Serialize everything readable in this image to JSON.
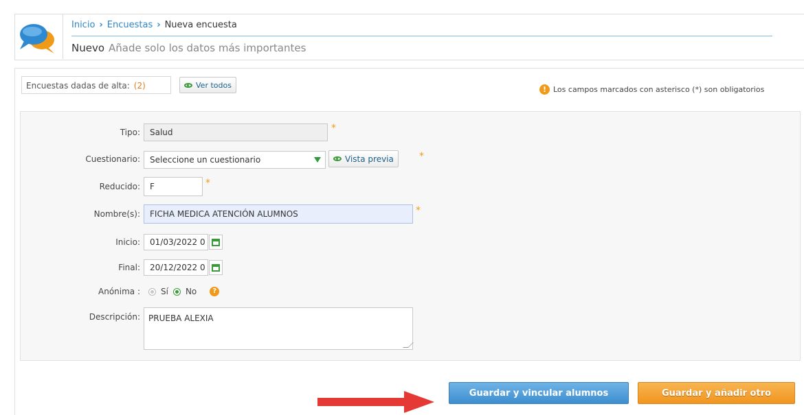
{
  "breadcrumb": {
    "home": "Inicio",
    "section": "Encuestas",
    "current": "Nueva encuesta"
  },
  "header": {
    "title": "Nuevo",
    "subtitle": "Añade solo los datos más importantes"
  },
  "summary": {
    "label": "Encuestas dadas de alta:",
    "count": "(2)",
    "view_all": "Ver todos"
  },
  "note": {
    "required_text": "Los campos marcados con asterisco (*) son obligatorios",
    "icon": "exclamation-icon"
  },
  "form": {
    "tipo": {
      "label": "Tipo:",
      "value": "Salud"
    },
    "cuestionario": {
      "label": "Cuestionario:",
      "value": "Seleccione un cuestionario",
      "preview": "Vista previa"
    },
    "reducido": {
      "label": "Reducido:",
      "value": "F"
    },
    "nombre": {
      "label": "Nombre(s):",
      "value": "FICHA MEDICA ATENCIÓN ALUMNOS"
    },
    "inicio": {
      "label": "Inicio:",
      "value": "01/03/2022 0"
    },
    "final": {
      "label": "Final:",
      "value": "20/12/2022 0"
    },
    "anonima": {
      "label": "Anónima :",
      "yes": "Sí",
      "no": "No",
      "selected": "No",
      "help": "?"
    },
    "descripcion": {
      "label": "Descripción:",
      "value": "PRUEBA ALEXIA"
    },
    "required_mark": "*"
  },
  "buttons": {
    "save_link": "Guardar y vincular alumnos",
    "save_add": "Guardar y añadir otro"
  },
  "colors": {
    "link": "#2e86c9",
    "accent_orange": "#f09a1a",
    "accent_green": "#3a9a3a",
    "arrow_red": "#e53935",
    "button_blue": "#4a9bd8"
  }
}
